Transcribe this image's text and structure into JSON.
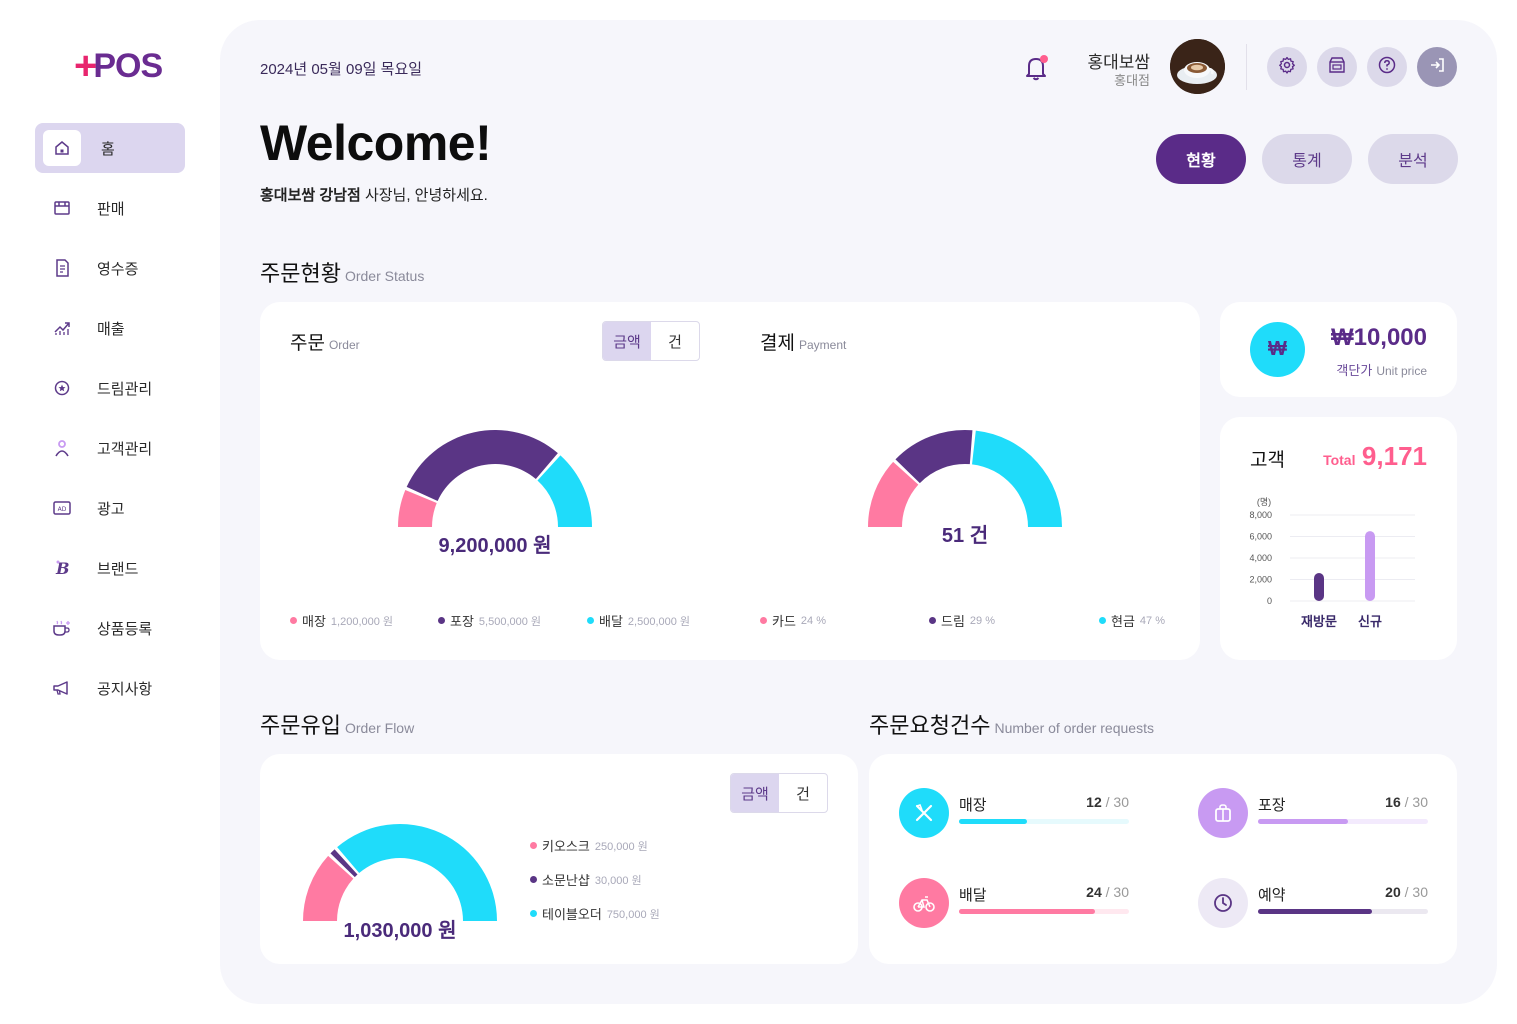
{
  "brand": {
    "logo_plus": "+",
    "logo_text": "POS"
  },
  "sidebar": {
    "items": [
      {
        "label": "홈",
        "icon": "home-icon",
        "active": true
      },
      {
        "label": "판매",
        "icon": "store-icon"
      },
      {
        "label": "영수증",
        "icon": "receipt-icon"
      },
      {
        "label": "매출",
        "icon": "trend-icon"
      },
      {
        "label": "드림관리",
        "icon": "star-circle-icon"
      },
      {
        "label": "고객관리",
        "icon": "person-icon"
      },
      {
        "label": "광고",
        "icon": "ad-icon"
      },
      {
        "label": "브랜드",
        "icon": "brand-b-icon"
      },
      {
        "label": "상품등록",
        "icon": "coffee-cup-icon"
      },
      {
        "label": "공지사항",
        "icon": "megaphone-icon"
      }
    ]
  },
  "header": {
    "date": "2024년 05월 09일 목요일",
    "user_name": "홍대보쌈",
    "branch": "홍대점",
    "icons": [
      "settings-icon",
      "store-box-icon",
      "help-icon",
      "logout-icon"
    ]
  },
  "welcome": {
    "title": "Welcome!",
    "greet_bold": "홍대보쌈 강남점",
    "greet_rest": " 사장님, 안녕하세요."
  },
  "view_tabs": [
    "현황",
    "통계",
    "분석"
  ],
  "order_status": {
    "title": "주문현황",
    "subtitle": "Order Status",
    "order": {
      "title": "주문",
      "subtitle": "Order",
      "toggle": [
        "금액",
        "건"
      ],
      "total": "9,200,000 원",
      "legend": [
        {
          "label": "매장",
          "value": "1,200,000 원",
          "share": 0.13,
          "color": "#ff7aa2"
        },
        {
          "label": "포장",
          "value": "5,500,000 원",
          "share": 0.6,
          "color": "#5a3585"
        },
        {
          "label": "배달",
          "value": "2,500,000 원",
          "share": 0.27,
          "color": "#1fdcfa"
        }
      ]
    },
    "payment": {
      "title": "결제",
      "subtitle": "Payment",
      "total": "51 건",
      "legend": [
        {
          "label": "카드",
          "value": "24 %",
          "share": 0.24,
          "color": "#ff7aa2"
        },
        {
          "label": "드림",
          "value": "29 %",
          "share": 0.29,
          "color": "#5a3585"
        },
        {
          "label": "현금",
          "value": "47 %",
          "share": 0.47,
          "color": "#1fdcfa"
        }
      ]
    }
  },
  "unit_price": {
    "value": "₩10,000",
    "label": "객단가",
    "label_sub": "Unit price",
    "icon_glyph": "₩"
  },
  "customers": {
    "title": "고객",
    "total_label": "Total",
    "total": "9,171",
    "unit": "(명)",
    "ticks": [
      "8,000",
      "6,000",
      "4,000",
      "2,000",
      "0"
    ],
    "categories": [
      "재방문",
      "신규"
    ],
    "values": [
      2600,
      6500
    ],
    "ymax": 8000,
    "colors": [
      "#5a3585",
      "#c89af2"
    ]
  },
  "order_flow": {
    "title": "주문유입",
    "subtitle": "Order Flow",
    "toggle": [
      "금액",
      "건"
    ],
    "total": "1,030,000 원",
    "legend": [
      {
        "label": "키오스크",
        "value": "250,000 원",
        "share": 0.24,
        "color": "#ff7aa2"
      },
      {
        "label": "소문난샵",
        "value": "30,000 원",
        "share": 0.03,
        "color": "#5a3585"
      },
      {
        "label": "테이블오더",
        "value": "750,000 원",
        "share": 0.73,
        "color": "#1fdcfa"
      }
    ]
  },
  "order_requests": {
    "title": "주문요청건수",
    "subtitle": "Number of order requests",
    "items": [
      {
        "label": "매장",
        "count": "12",
        "max": "30",
        "ratio": 0.4,
        "color": "#1fdcfa",
        "track": "#e6fafd",
        "icon": "utensils-icon"
      },
      {
        "label": "포장",
        "count": "16",
        "max": "30",
        "ratio": 0.53,
        "color": "#c89af2",
        "track": "#f3eafd",
        "icon": "bag-icon"
      },
      {
        "label": "배달",
        "count": "24",
        "max": "30",
        "ratio": 0.8,
        "color": "#ff7aa2",
        "track": "#ffe8ef",
        "icon": "bike-icon"
      },
      {
        "label": "예약",
        "count": "20",
        "max": "30",
        "ratio": 0.67,
        "color": "#5a3585",
        "track": "#ebe8f0",
        "icon": "clock-icon"
      }
    ]
  }
}
